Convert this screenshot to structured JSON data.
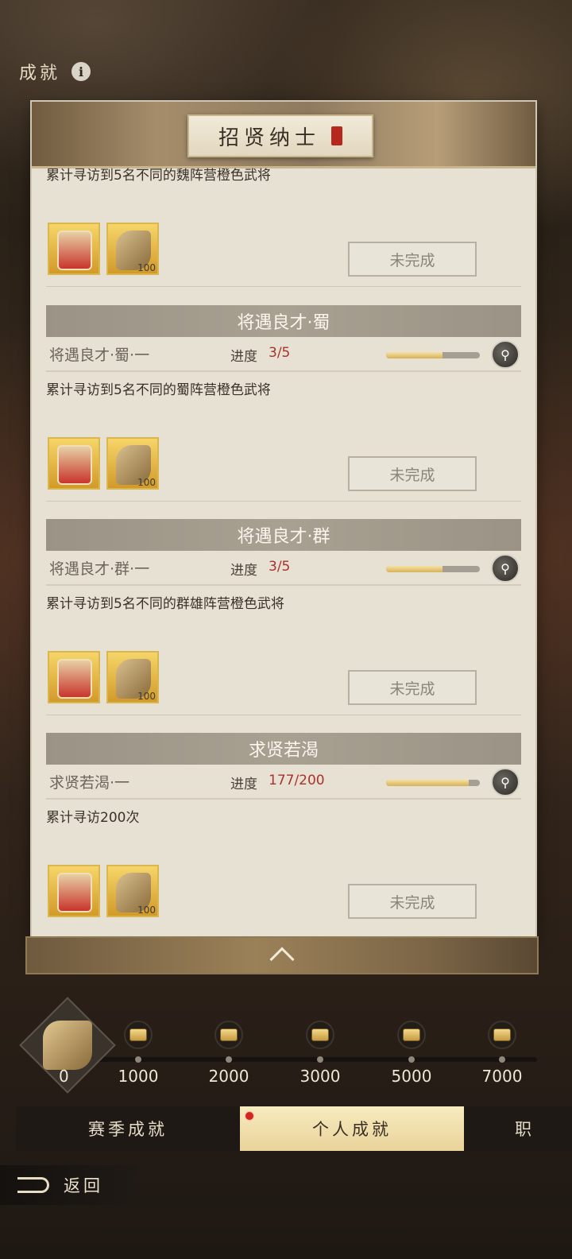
{
  "page": {
    "title": "成就"
  },
  "panel": {
    "title": "招贤纳士"
  },
  "entries": [
    {
      "section": null,
      "achievement": null,
      "progress_label": null,
      "progress_value": null,
      "progress_fraction": null,
      "description": "累计寻访到5名不同的魏阵营橙色武将",
      "rewards": [
        {
          "icon": "token-icon",
          "qty": ""
        },
        {
          "icon": "scroll-icon",
          "qty": "100"
        }
      ],
      "button": "未完成"
    },
    {
      "section": "将遇良才·蜀",
      "achievement": "将遇良才·蜀·一",
      "progress_label": "进度",
      "progress_value": "3/5",
      "progress_fraction": 0.6,
      "description": "累计寻访到5名不同的蜀阵营橙色武将",
      "rewards": [
        {
          "icon": "token-icon",
          "qty": ""
        },
        {
          "icon": "scroll-icon",
          "qty": "100"
        }
      ],
      "button": "未完成"
    },
    {
      "section": "将遇良才·群",
      "achievement": "将遇良才·群·一",
      "progress_label": "进度",
      "progress_value": "3/5",
      "progress_fraction": 0.6,
      "description": "累计寻访到5名不同的群雄阵营橙色武将",
      "rewards": [
        {
          "icon": "token-icon",
          "qty": ""
        },
        {
          "icon": "scroll-icon",
          "qty": "100"
        }
      ],
      "button": "未完成"
    },
    {
      "section": "求贤若渴",
      "achievement": "求贤若渴·一",
      "progress_label": "进度",
      "progress_value": "177/200",
      "progress_fraction": 0.885,
      "description": "累计寻访200次",
      "rewards": [
        {
          "icon": "token-icon",
          "qty": ""
        },
        {
          "icon": "scroll-icon",
          "qty": "100"
        }
      ],
      "button": "未完成"
    }
  ],
  "milestones": {
    "current": "0",
    "values": [
      "1000",
      "2000",
      "3000",
      "5000",
      "7000"
    ]
  },
  "tabs": [
    {
      "label": "赛季成就",
      "active": false,
      "badge": false
    },
    {
      "label": "个人成就",
      "active": true,
      "badge": true
    },
    {
      "label": "职",
      "active": false,
      "badge": false
    }
  ],
  "back": {
    "label": "返回"
  },
  "colors": {
    "progress_red": "#a8322c",
    "tab_active": "#f2e2ae",
    "panel_bg": "#e7e1d4"
  }
}
